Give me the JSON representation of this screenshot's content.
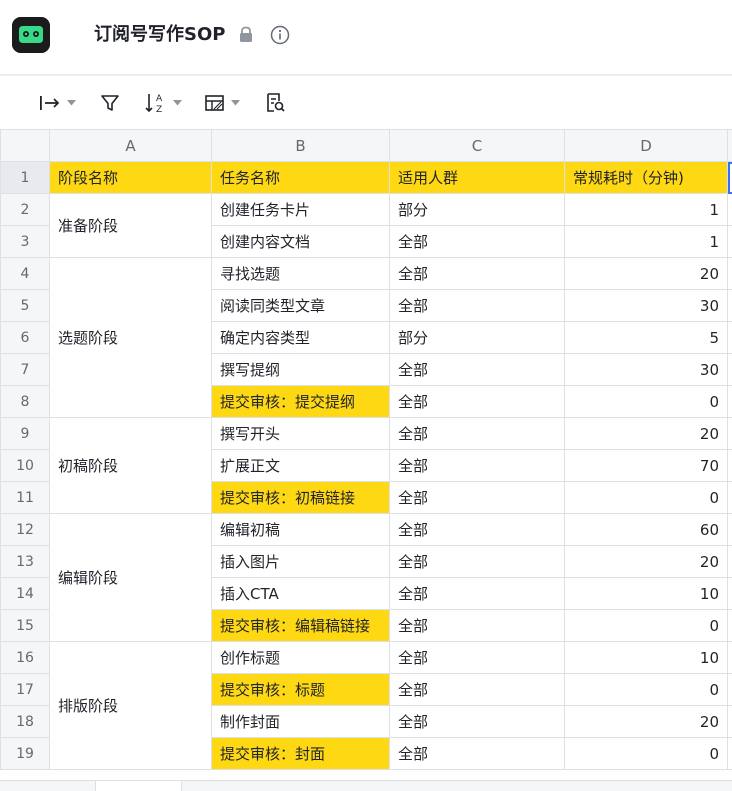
{
  "header": {
    "title": "订阅号写作SOP",
    "lock_icon": "lock-icon",
    "info_icon": "info-icon",
    "logo_icon": "app-logo-icon"
  },
  "toolbar": {
    "items": [
      {
        "icon": "freeze-column-icon",
        "has_dropdown": true
      },
      {
        "icon": "filter-icon",
        "has_dropdown": false
      },
      {
        "icon": "sort-az-icon",
        "has_dropdown": true
      },
      {
        "icon": "cell-style-icon",
        "has_dropdown": true
      },
      {
        "icon": "find-replace-icon",
        "has_dropdown": false
      }
    ]
  },
  "colors": {
    "highlight": "#ffd814",
    "grid_line": "#dee0e3",
    "header_bg": "#f5f6f7",
    "selection": "#3370ff"
  },
  "sheet": {
    "columns": [
      "A",
      "B",
      "C",
      "D"
    ],
    "header_row": {
      "num": "1",
      "a": "阶段名称",
      "b": "任务名称",
      "c": "适用人群",
      "d": "常规耗时（分钟)"
    },
    "groups": [
      {
        "name": "准备阶段",
        "rows": [
          {
            "num": "2",
            "task": "创建任务卡片",
            "audience": "部分",
            "minutes": "1",
            "highlight": false
          },
          {
            "num": "3",
            "task": "创建内容文档",
            "audience": "全部",
            "minutes": "1",
            "highlight": false
          }
        ]
      },
      {
        "name": "选题阶段",
        "rows": [
          {
            "num": "4",
            "task": "寻找选题",
            "audience": "全部",
            "minutes": "20",
            "highlight": false
          },
          {
            "num": "5",
            "task": "阅读同类型文章",
            "audience": "全部",
            "minutes": "30",
            "highlight": false
          },
          {
            "num": "6",
            "task": "确定内容类型",
            "audience": "部分",
            "minutes": "5",
            "highlight": false
          },
          {
            "num": "7",
            "task": "撰写提纲",
            "audience": "全部",
            "minutes": "30",
            "highlight": false
          },
          {
            "num": "8",
            "task": "提交审核：提交提纲",
            "audience": "全部",
            "minutes": "0",
            "highlight": true
          }
        ]
      },
      {
        "name": "初稿阶段",
        "rows": [
          {
            "num": "9",
            "task": "撰写开头",
            "audience": "全部",
            "minutes": "20",
            "highlight": false
          },
          {
            "num": "10",
            "task": "扩展正文",
            "audience": "全部",
            "minutes": "70",
            "highlight": false
          },
          {
            "num": "11",
            "task": "提交审核：初稿链接",
            "audience": "全部",
            "minutes": "0",
            "highlight": true
          }
        ]
      },
      {
        "name": "编辑阶段",
        "rows": [
          {
            "num": "12",
            "task": "编辑初稿",
            "audience": "全部",
            "minutes": "60",
            "highlight": false
          },
          {
            "num": "13",
            "task": "插入图片",
            "audience": "全部",
            "minutes": "20",
            "highlight": false
          },
          {
            "num": "14",
            "task": "插入CTA",
            "audience": "全部",
            "minutes": "10",
            "highlight": false
          },
          {
            "num": "15",
            "task": "提交审核：编辑稿链接",
            "audience": "全部",
            "minutes": "0",
            "highlight": true
          }
        ]
      },
      {
        "name": "排版阶段",
        "rows": [
          {
            "num": "16",
            "task": "创作标题",
            "audience": "全部",
            "minutes": "10",
            "highlight": false
          },
          {
            "num": "17",
            "task": "提交审核：标题",
            "audience": "全部",
            "minutes": "0",
            "highlight": true
          },
          {
            "num": "18",
            "task": "制作封面",
            "audience": "全部",
            "minutes": "20",
            "highlight": false
          },
          {
            "num": "19",
            "task": "提交审核：封面",
            "audience": "全部",
            "minutes": "0",
            "highlight": true
          }
        ]
      }
    ]
  }
}
